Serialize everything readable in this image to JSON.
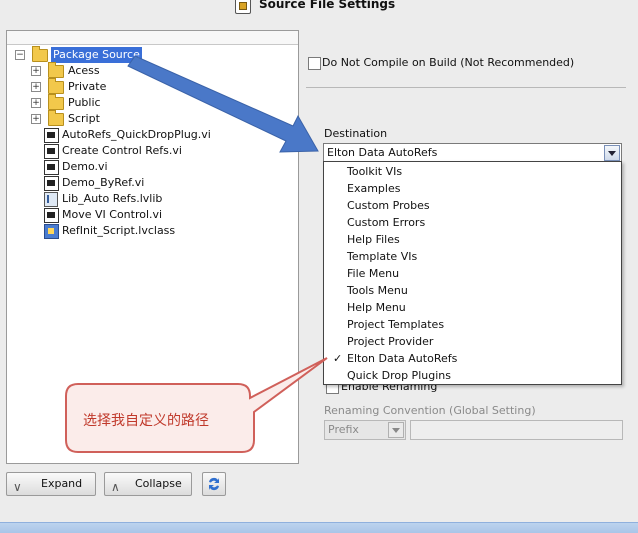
{
  "window": {
    "title": "Source File Settings"
  },
  "tree": {
    "items": [
      {
        "label": "Package Source",
        "type": "folder",
        "expander": "−",
        "level": 0,
        "selected": true
      },
      {
        "label": "Acess",
        "type": "folder",
        "expander": "+",
        "level": 1
      },
      {
        "label": "Private",
        "type": "folder",
        "expander": "+",
        "level": 1
      },
      {
        "label": "Public",
        "type": "folder",
        "expander": "+",
        "level": 1
      },
      {
        "label": "Script",
        "type": "folder",
        "expander": "+",
        "level": 1
      },
      {
        "label": "AutoRefs_QuickDropPlug.vi",
        "type": "vi",
        "level": 1
      },
      {
        "label": "Create Control Refs.vi",
        "type": "vi",
        "level": 1
      },
      {
        "label": "Demo.vi",
        "type": "vi",
        "level": 1
      },
      {
        "label": "Demo_ByRef.vi",
        "type": "vi",
        "level": 1
      },
      {
        "label": "Lib_Auto Refs.lvlib",
        "type": "lvlib",
        "level": 1
      },
      {
        "label": "Move VI Control.vi",
        "type": "vi",
        "level": 1
      },
      {
        "label": "RefInit_Script.lvclass",
        "type": "lvclass",
        "level": 1
      }
    ]
  },
  "buttons": {
    "expand_label": "Expand",
    "collapse_label": "Collapse"
  },
  "settings": {
    "do_not_compile_label": "Do Not Compile on Build (Not Recommended)",
    "destination_label": "Destination",
    "destination_value": "Elton Data AutoRefs",
    "destination_options": [
      "Toolkit VIs",
      "Examples",
      "Custom Probes",
      "Custom Errors",
      "Help Files",
      "Template VIs",
      "File Menu",
      "Tools Menu",
      "Help Menu",
      "Project Templates",
      "Project Provider",
      "Elton Data AutoRefs",
      "Quick Drop Plugins"
    ],
    "selected_option_index": 11,
    "check_glyph": "✓",
    "enable_renaming_label": "Enable Renaming",
    "renaming_convention_label": "Renaming Convention (Global Setting)",
    "renaming_prefix_value": "Prefix"
  },
  "annotation": {
    "callout_text": "选择我自定义的路径",
    "callout_color": "#c0392b",
    "arrow_color": "#4a78c8"
  },
  "colors": {
    "selection": "#3a6fd8",
    "folder": "#f2c84b"
  }
}
